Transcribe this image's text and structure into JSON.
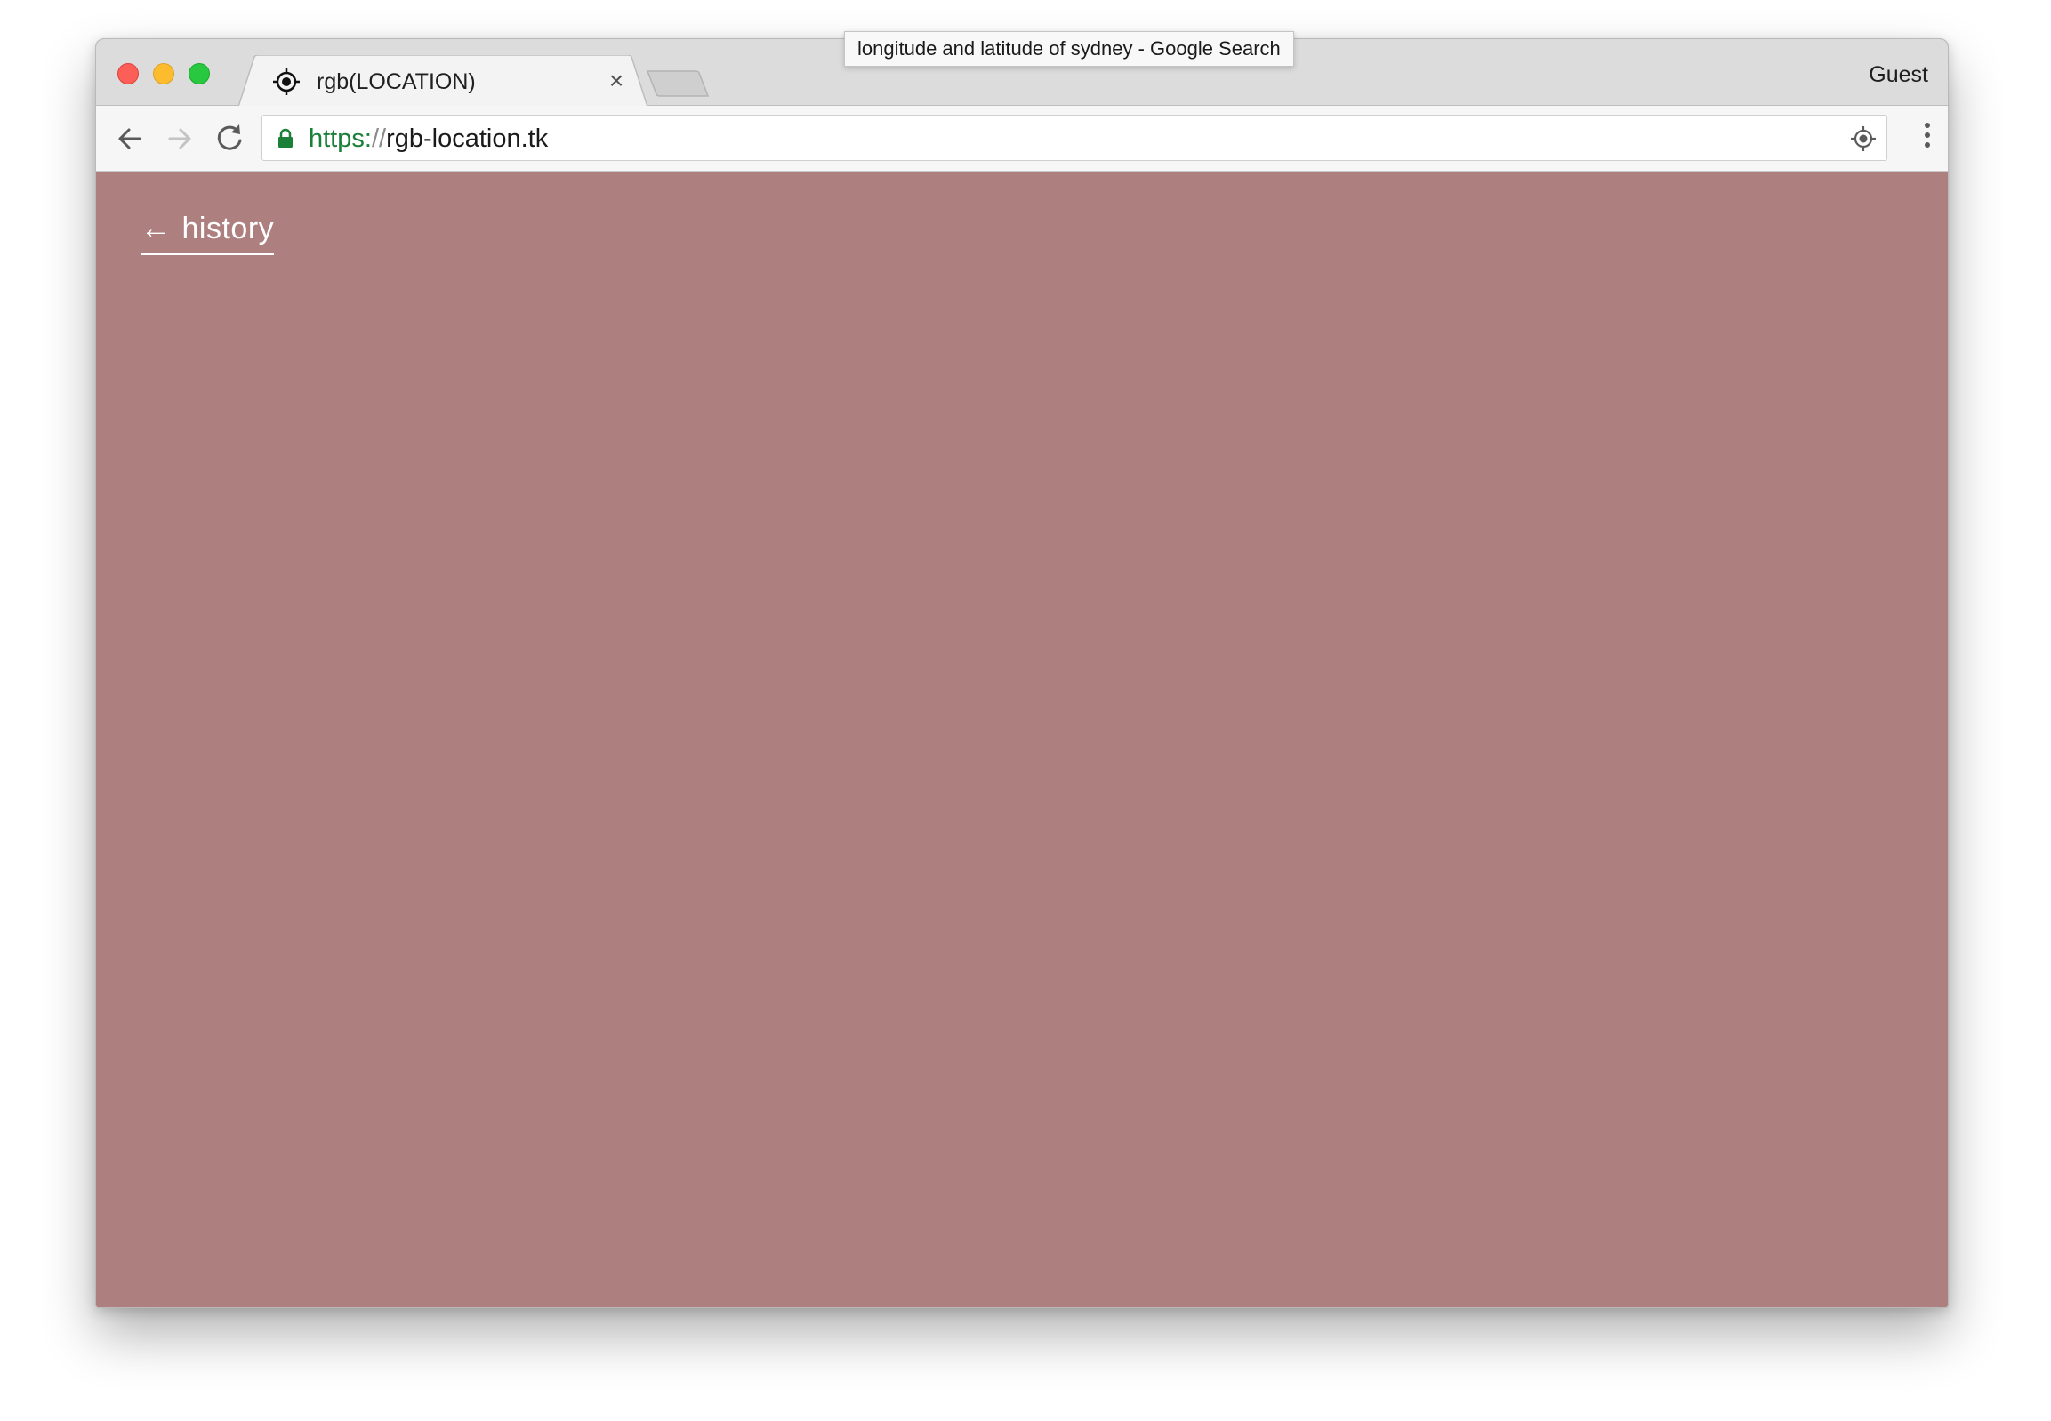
{
  "tooltip": {
    "text": "longitude and latitude of sydney - Google Search"
  },
  "browser": {
    "tab": {
      "title": "rgb(LOCATION)",
      "close_glyph": "×",
      "favicon": "location-target-icon"
    },
    "profile_label": "Guest",
    "address": {
      "scheme": "https:",
      "separator": "//",
      "host": "rgb-location.tk"
    },
    "icons": {
      "back": "arrow-left-icon",
      "forward": "arrow-right-icon",
      "reload": "reload-icon",
      "lock": "lock-icon",
      "location": "location-target-icon",
      "menu": "more-vert-icon"
    }
  },
  "page": {
    "background_color": "#ad7f7e",
    "history_link": {
      "arrow": "←",
      "label": "history"
    }
  },
  "colors": {
    "traffic_close": "#fc5f57",
    "traffic_minimize": "#fdbc2e",
    "traffic_maximize": "#28c840",
    "secure_scheme": "#1a7f37"
  }
}
